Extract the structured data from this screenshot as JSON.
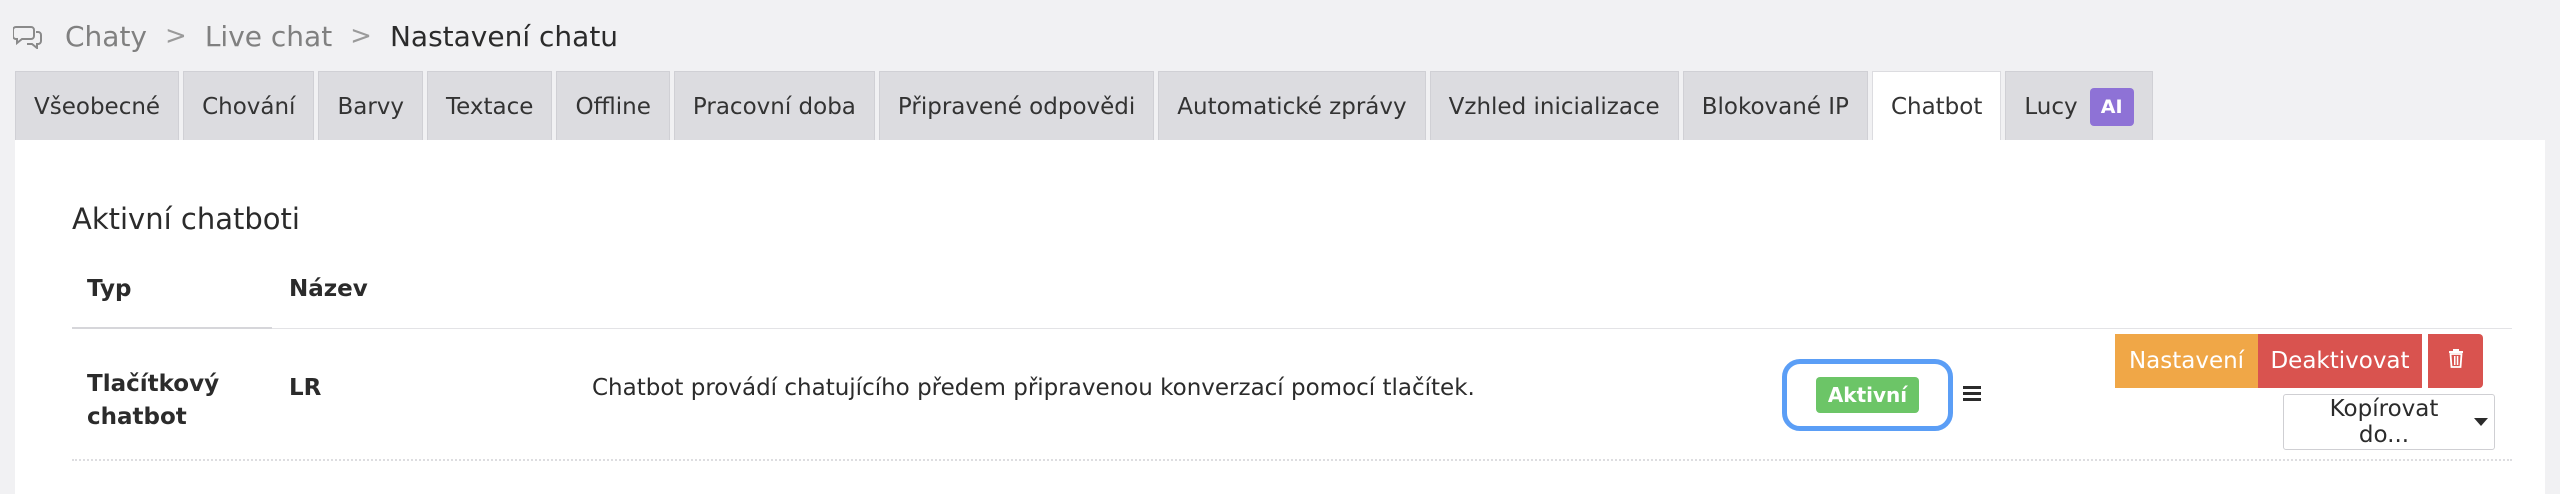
{
  "breadcrumb": {
    "icon": "chat-bubbles-icon",
    "items": [
      "Chaty",
      "Live chat"
    ],
    "separator": ">",
    "current": "Nastavení chatu"
  },
  "tabs": [
    {
      "label": "Všeobecné"
    },
    {
      "label": "Chování"
    },
    {
      "label": "Barvy"
    },
    {
      "label": "Textace"
    },
    {
      "label": "Offline"
    },
    {
      "label": "Pracovní doba"
    },
    {
      "label": "Připravené odpovědi"
    },
    {
      "label": "Automatické zprávy"
    },
    {
      "label": "Vzhled inicializace"
    },
    {
      "label": "Blokované IP"
    },
    {
      "label": "Chatbot",
      "active": true
    },
    {
      "label": "Lucy",
      "badge": "AI"
    }
  ],
  "section": {
    "title": "Aktivní chatboti"
  },
  "table": {
    "headers": {
      "type": "Typ",
      "name": "Název"
    },
    "rows": [
      {
        "type": "Tlačítkový chatbot",
        "name": "LR",
        "description": "Chatbot provádí chatujícího předem připravenou konverzací pomocí tlačítek.",
        "status": "Aktivní",
        "actions": {
          "settings": "Nastavení",
          "deactivate": "Deaktivovat",
          "delete_icon": "trash-icon",
          "copy": "Kopírovat do..."
        }
      }
    ]
  },
  "colors": {
    "status_green": "#6cc567",
    "settings_orange": "#f0a747",
    "danger_red": "#d9534f",
    "focus_blue": "#5b9ef6",
    "ai_purple": "#8e72d6"
  }
}
